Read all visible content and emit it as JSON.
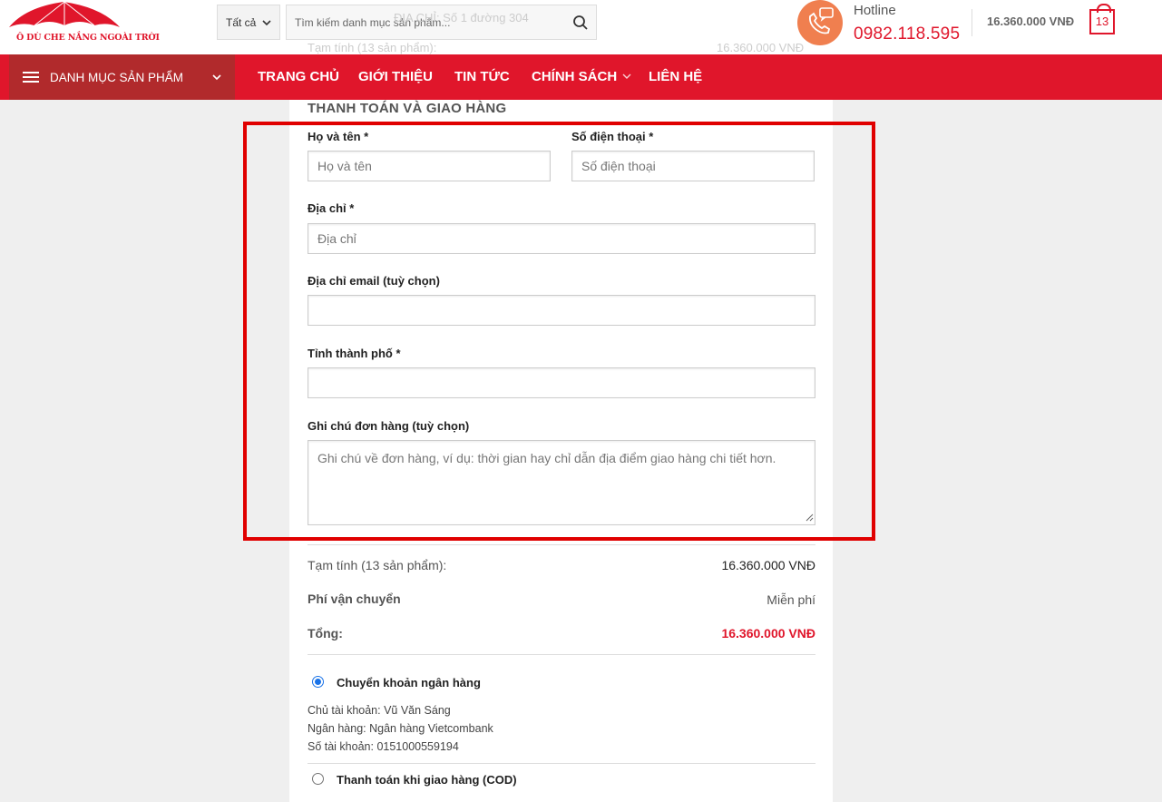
{
  "header": {
    "logo_text": "Ô DÙ CHE NẮNG NGOÀI TRỜI",
    "category_select": "Tất cả",
    "search_placeholder": "Tìm kiếm danh mục sản phẩm...",
    "behind_search_text": "ĐỊA CHỈ: Số 1 đường 304",
    "behind_subtotal_label": "Tạm tính (13 sản phẩm):",
    "behind_subtotal_value": "16.360.000 VNĐ",
    "hotline_label": "Hotline",
    "hotline_number": "0982.118.595",
    "cart_total": "16.360.000  VNĐ",
    "cart_count": "13"
  },
  "nav": {
    "menu_label": "DANH MỤC SẢN PHẨM",
    "items": [
      "TRANG CHỦ",
      "GIỚI THIỆU",
      "TIN TỨC",
      "CHÍNH SÁCH",
      "LIÊN HỆ"
    ]
  },
  "form": {
    "title": "THANH TOÁN VÀ GIAO HÀNG",
    "name_label": "Họ và tên *",
    "name_placeholder": "Họ và tên",
    "phone_label": "Số điện thoại *",
    "phone_placeholder": "Số điện thoại",
    "address_label": "Địa chỉ *",
    "address_placeholder": "Địa chỉ",
    "email_label": "Địa chỉ email (tuỳ chọn)",
    "city_label": "Tỉnh thành phố *",
    "note_label": "Ghi chú đơn hàng (tuỳ chọn)",
    "note_placeholder": "Ghi chú về đơn hàng, ví dụ: thời gian hay chỉ dẫn địa điểm giao hàng chi tiết hơn."
  },
  "summary": {
    "subtotal_label": "Tạm tính (13 sản phẩm):",
    "subtotal_value": "16.360.000  VNĐ",
    "shipping_label": "Phí vận chuyển",
    "shipping_value": "Miễn phí",
    "total_label": "Tổng:",
    "total_value": "16.360.000  VNĐ"
  },
  "payment": {
    "bank_label": "Chuyển khoản ngân hàng",
    "bank_lines": [
      "Chủ tài khoản: Vũ Văn Sáng",
      "Ngân hàng: Ngân hàng Vietcombank",
      "Số tài khoản: 0151000559194"
    ],
    "cod_label": "Thanh toán khi giao hàng (COD)"
  },
  "colors": {
    "brand_red": "#e0162b",
    "menu_dark_red": "#b12a2c",
    "hotline_orange": "#f07f4f",
    "highlight_red": "#e00000"
  }
}
